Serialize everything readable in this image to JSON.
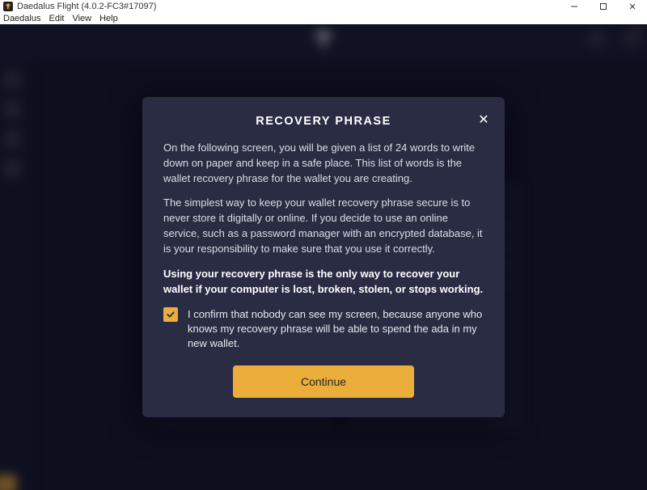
{
  "window": {
    "title": "Daedalus Flight (4.0.2-FC3#17097)"
  },
  "menu": {
    "items": [
      "Daedalus",
      "Edit",
      "View",
      "Help"
    ]
  },
  "modal": {
    "title": "RECOVERY PHRASE",
    "p1": "On the following screen, you will be given a list of 24 words to write down on paper and keep in a safe place. This list of words is the wallet recovery phrase for the wallet you are creating.",
    "p2": "The simplest way to keep your wallet recovery phrase secure is to never store it digitally or online. If you decide to use an online service, such as a password manager with an encrypted database, it is your responsibility to make sure that you use it correctly.",
    "p3": "Using your recovery phrase is the only way to recover your wallet if your computer is lost, broken, stolen, or stops working.",
    "confirm": "I confirm that nobody can see my screen, because anyone who knows my recovery phrase will be able to spend the ada in my new wallet.",
    "checked": true,
    "continue_label": "Continue"
  }
}
